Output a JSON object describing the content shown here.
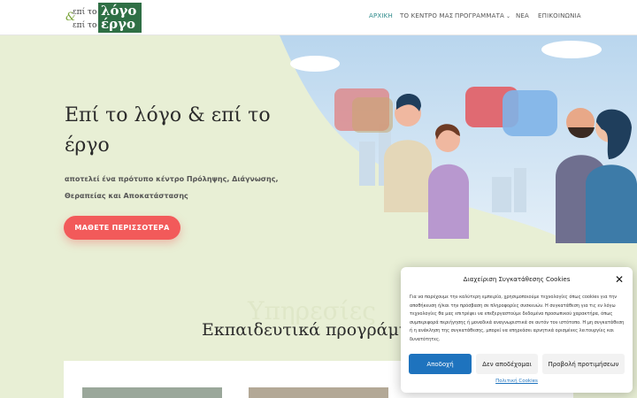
{
  "logo": {
    "line1": "επί το",
    "line2": "επί το",
    "word1": "λόγο",
    "word2": "έργο",
    "amp": "&"
  },
  "nav": [
    {
      "label": "ΑΡΧΙΚΗ",
      "active": true
    },
    {
      "label": "ΤΟ ΚΕΝΤΡΟ ΜΑΣ",
      "active": false
    },
    {
      "label": "ΠΡΟΓΡΑΜΜΑΤΑ",
      "active": false,
      "has_dropdown": true
    },
    {
      "label": "ΝΕΑ",
      "active": false
    },
    {
      "label": "ΕΠΙΚΟΙΝΩΝΙΑ",
      "active": false
    }
  ],
  "hero": {
    "title": "Επί το λόγο & επί το έργο",
    "subtitle": "αποτελεί ένα πρότυπο κέντρο Πρόληψης, Διάγνωσης, Θεραπείας και Αποκατάστασης",
    "cta": "ΜΑΘΕΤΕ ΠΕΡΙΣΣΟΤΕΡΑ"
  },
  "section": {
    "ghost": "Υπηρεσίες",
    "title": "Εκπαιδευτικά προγράμματα"
  },
  "cookie": {
    "title": "Διαχείριση Συγκατάθεσης Cookies",
    "text": "Για να παρέχουμε την καλύτερη εμπειρία, χρησιμοποιούμε τεχνολογίες όπως cookies για την αποθήκευση ή/και την πρόσβαση σε πληροφορίες συσκευών. Η συγκατάθεση για τις εν λόγω τεχνολογίες θα μας επιτρέψει να επεξεργαστούμε δεδομένα προσωπικού χαρακτήρα, όπως συμπεριφορά περιήγησης ή μοναδικά αναγνωριστικά σε αυτόν τον ιστότοπο. Η μη συγκατάθεση ή η ανάκληση της συγκατάθεσης, μπορεί να επηρεάσει αρνητικά ορισμένες λειτουργίες και δυνατότητες.",
    "accept": "Αποδοχή",
    "deny": "Δεν αποδέχομαι",
    "prefs": "Προβολή προτιμήσεων",
    "policy": "Πολιτική Cookies"
  },
  "colors": {
    "background": "#e8efd5",
    "accent": "#f25a5a",
    "nav_active": "#2d8a8a",
    "cookie_button": "#1e73be",
    "logo_green": "#2f6f45"
  }
}
